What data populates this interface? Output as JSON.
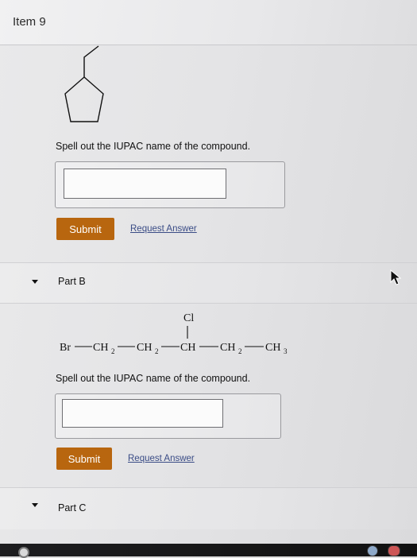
{
  "header": {
    "title": "Item 9"
  },
  "part_a": {
    "prompt": "Spell out the IUPAC name of the compound.",
    "input_value": "",
    "submit_label": "Submit",
    "request_label": "Request Answer"
  },
  "part_b": {
    "label": "Part B",
    "formula": {
      "substituent": "Cl",
      "chain": [
        "Br",
        "CH",
        "CH",
        "CH",
        "CH",
        "CH"
      ],
      "subscripts": [
        "",
        "2",
        "2",
        "",
        "2",
        "3"
      ]
    },
    "prompt": "Spell out the IUPAC name of the compound.",
    "input_value": "",
    "submit_label": "Submit",
    "request_label": "Request Answer"
  },
  "part_c": {
    "label": "Part C"
  },
  "icons": {
    "part_b_caret": "chevron-down-icon",
    "part_c_caret": "chevron-down-icon",
    "cursor": "mouse-pointer-icon",
    "launcher": "launcher-icon"
  },
  "colors": {
    "button": "#b8660f",
    "link": "#3a4c86",
    "taskbar": "#111111"
  }
}
